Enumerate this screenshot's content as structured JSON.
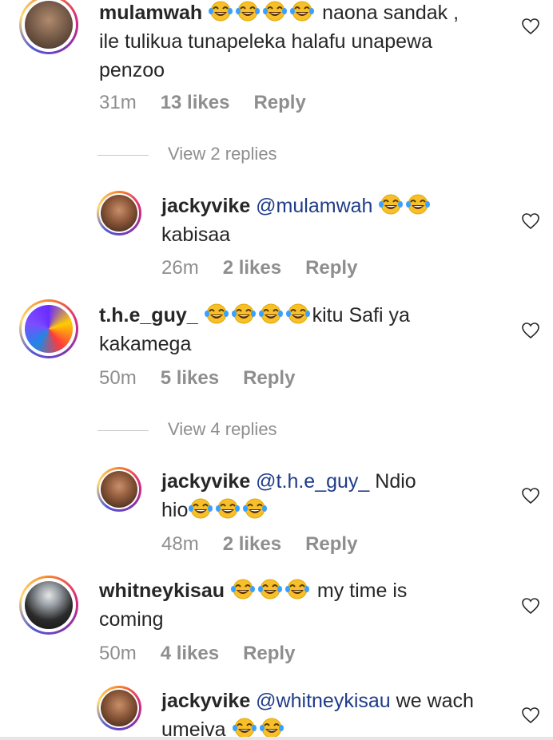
{
  "icons": {
    "emoji": "face-with-tears-of-joy-icon",
    "like": "heart-outline-icon"
  },
  "colors": {
    "mention": "#1f3c88",
    "meta": "#8e8e8e",
    "text": "#262626"
  },
  "comments": [
    {
      "user": "mulamwah",
      "line1_tail": " naona sandak ,",
      "line2": "ile tulikua tunapeleka halafu unapewa",
      "line3": "penzoo",
      "time": "31m",
      "likes": "13 likes",
      "reply": "Reply"
    },
    {
      "view_replies": "View 2 replies"
    },
    {
      "user": "jackyvike",
      "mention": "@mulamwah",
      "line2": "kabisaa",
      "time": "26m",
      "likes": "2 likes",
      "reply": "Reply"
    },
    {
      "user": "t.h.e_guy_",
      "line1_tail": "kitu Safi ya",
      "line2": "kakamega",
      "time": "50m",
      "likes": "5 likes",
      "reply": "Reply"
    },
    {
      "view_replies": "View 4 replies"
    },
    {
      "user": "jackyvike",
      "mention": "@t.h.e_guy_",
      "line1_tail": " Ndio",
      "line2": "hio",
      "time": "48m",
      "likes": "2 likes",
      "reply": "Reply"
    },
    {
      "user": "whitneykisau",
      "line1_tail": " my time is",
      "line2": "coming",
      "time": "50m",
      "likes": "4 likes",
      "reply": "Reply"
    },
    {
      "user": "jackyvike",
      "mention": "@whitneykisau",
      "line1_tail": " we wach",
      "line2": "umeiva"
    }
  ]
}
